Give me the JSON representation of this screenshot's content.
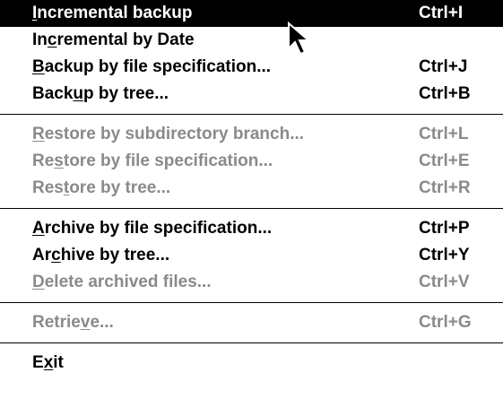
{
  "menu": {
    "items": [
      {
        "pre": "",
        "ul": "I",
        "post": "ncremental backup",
        "shortcut": "Ctrl+I"
      },
      {
        "pre": "In",
        "ul": "c",
        "post": "remental by Date",
        "shortcut": ""
      },
      {
        "pre": "",
        "ul": "B",
        "post": "ackup by file specification...",
        "shortcut": "Ctrl+J"
      },
      {
        "pre": "Back",
        "ul": "u",
        "post": "p by tree...",
        "shortcut": "Ctrl+B"
      },
      {
        "pre": "",
        "ul": "R",
        "post": "estore by subdirectory branch...",
        "shortcut": "Ctrl+L"
      },
      {
        "pre": "Re",
        "ul": "s",
        "post": "tore by file specification...",
        "shortcut": "Ctrl+E"
      },
      {
        "pre": "Res",
        "ul": "t",
        "post": "ore by tree...",
        "shortcut": "Ctrl+R"
      },
      {
        "pre": "",
        "ul": "A",
        "post": "rchive by file specification...",
        "shortcut": "Ctrl+P"
      },
      {
        "pre": "Ar",
        "ul": "c",
        "post": "hive by tree...",
        "shortcut": "Ctrl+Y"
      },
      {
        "pre": "",
        "ul": "D",
        "post": "elete archived files...",
        "shortcut": "Ctrl+V"
      },
      {
        "pre": "Retrie",
        "ul": "v",
        "post": "e...",
        "shortcut": "Ctrl+G"
      },
      {
        "pre": "E",
        "ul": "x",
        "post": "it",
        "shortcut": ""
      }
    ]
  },
  "colors": {
    "highlight": "#000000",
    "highlight_text": "#ffffff",
    "disabled_text": "#8a8a8a"
  },
  "cursor_icon": "arrow-cursor-icon"
}
